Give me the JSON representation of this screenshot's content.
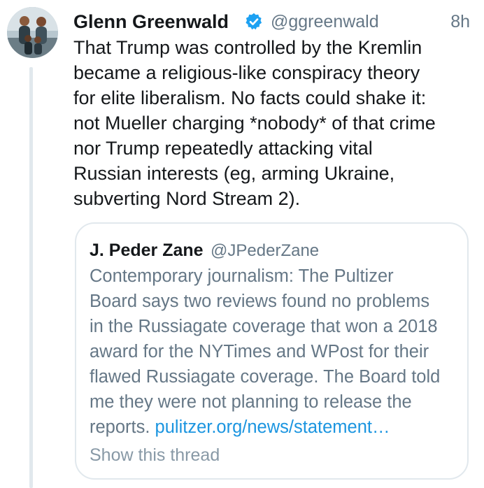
{
  "tweet": {
    "display_name": "Glenn Greenwald",
    "handle": "@ggreenwald",
    "timestamp": "8h",
    "verified": true,
    "avatar_icon": "profile-photo-family",
    "text_lines": [
      "That Trump was controlled by the Kremlin",
      "became a religious-like conspiracy theory",
      "for elite liberalism. No facts could shake it:",
      "not Mueller charging *nobody* of that crime",
      "nor Trump repeatedly attacking vital",
      "Russian interests (eg, arming Ukraine,",
      "subverting Nord Stream 2)."
    ]
  },
  "quoted_tweet": {
    "display_name": "J. Peder Zane",
    "handle": "@JPederZane",
    "text_lines": [
      "Contemporary journalism: The Pultizer",
      "Board says two reviews found no problems",
      "in the Russiagate coverage that won a 2018",
      "award for the NYTimes and WPost for their",
      "flawed Russiagate coverage. The Board told",
      "me they were not planning to release the"
    ],
    "last_line_text": "reports.",
    "link_text": "pulitzer.org/news/statement…",
    "show_thread_label": "Show this thread"
  },
  "colors": {
    "text_primary": "#14171a",
    "text_secondary": "#657786",
    "link": "#1b95e0",
    "verified": "#1da1f2",
    "border": "#e1e8ed"
  }
}
